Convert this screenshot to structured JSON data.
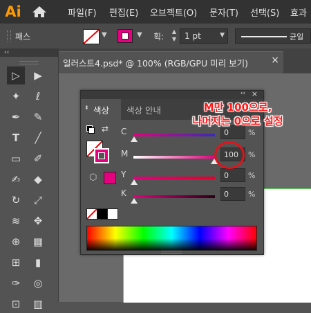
{
  "app": {
    "logo": "Ai"
  },
  "menubar": {
    "items": [
      "파일(F)",
      "편집(E)",
      "오브젝트(O)",
      "문자(T)",
      "선택(S)",
      "효과"
    ]
  },
  "controlbar": {
    "label": "패스",
    "stroke_label": "획:",
    "stroke_value": "1 pt",
    "profile_label": "균일"
  },
  "document": {
    "tab_title": "일러스트4.psd* @ 100% (RGB/GPU 미리 보기)",
    "close": "×"
  },
  "color_panel": {
    "tabs": [
      "색상",
      "색상 안내"
    ],
    "sliders": [
      {
        "label": "C",
        "value": "0",
        "unit": "%"
      },
      {
        "label": "M",
        "value": "100",
        "unit": "%"
      },
      {
        "label": "Y",
        "value": "0",
        "unit": "%"
      },
      {
        "label": "K",
        "value": "0",
        "unit": "%"
      }
    ],
    "header_buttons": [
      "‹‹",
      "×"
    ]
  },
  "annotation": {
    "line1": "M만 100으로,",
    "line2": "나머지는 0으로 설정"
  },
  "colors": {
    "magenta": "#e4007f",
    "accent": "#ff9a00",
    "annotation": "#ff1a1a"
  }
}
